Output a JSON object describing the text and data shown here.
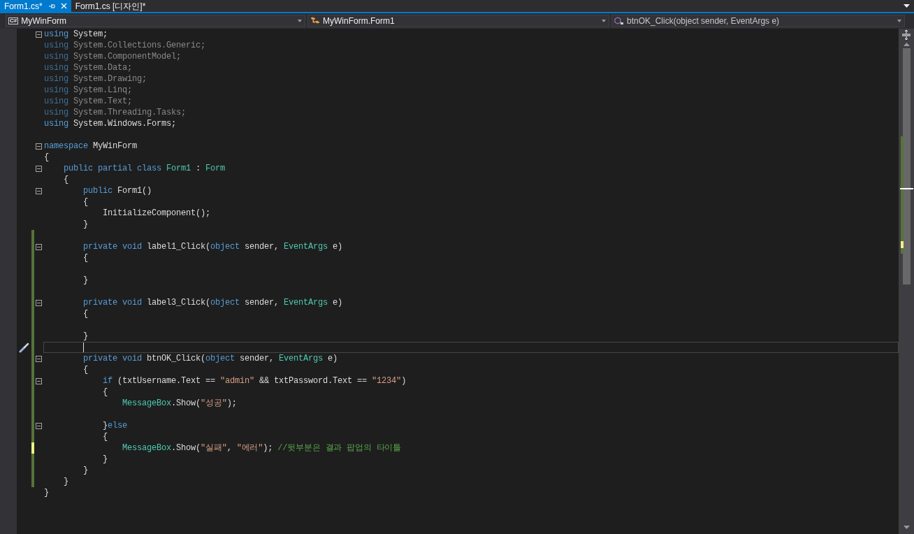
{
  "tabs": [
    {
      "label": "Form1.cs*",
      "selected": true,
      "pinned": true
    },
    {
      "label": "Form1.cs [디자인]*",
      "selected": false,
      "pinned": false
    }
  ],
  "nav_bar": {
    "project_icon": "C#",
    "project": "MyWinForm",
    "class": "MyWinForm.Form1",
    "member": "btnOK_Click(object sender, EventArgs e)"
  },
  "lines": [
    {
      "fold": true,
      "current": false,
      "tokens": [
        {
          "kind": "keyword",
          "text": "using"
        },
        {
          "kind": "plain",
          "text": " System;"
        }
      ]
    },
    {
      "fold": false,
      "current": false,
      "tokens": [
        {
          "kind": "dim_keyword",
          "text": "using"
        },
        {
          "kind": "dim",
          "text": " System.Collections.Generic;"
        }
      ]
    },
    {
      "fold": false,
      "current": false,
      "tokens": [
        {
          "kind": "dim_keyword",
          "text": "using"
        },
        {
          "kind": "dim",
          "text": " System.ComponentModel;"
        }
      ]
    },
    {
      "fold": false,
      "current": false,
      "tokens": [
        {
          "kind": "dim_keyword",
          "text": "using"
        },
        {
          "kind": "dim",
          "text": " System.Data;"
        }
      ]
    },
    {
      "fold": false,
      "current": false,
      "tokens": [
        {
          "kind": "dim_keyword",
          "text": "using"
        },
        {
          "kind": "dim",
          "text": " System.Drawing;"
        }
      ]
    },
    {
      "fold": false,
      "current": false,
      "tokens": [
        {
          "kind": "dim_keyword",
          "text": "using"
        },
        {
          "kind": "dim",
          "text": " System.Linq;"
        }
      ]
    },
    {
      "fold": false,
      "current": false,
      "tokens": [
        {
          "kind": "dim_keyword",
          "text": "using"
        },
        {
          "kind": "dim",
          "text": " System.Text;"
        }
      ]
    },
    {
      "fold": false,
      "current": false,
      "tokens": [
        {
          "kind": "dim_keyword",
          "text": "using"
        },
        {
          "kind": "dim",
          "text": " System.Threading.Tasks;"
        }
      ]
    },
    {
      "fold": false,
      "current": false,
      "tokens": [
        {
          "kind": "keyword",
          "text": "using"
        },
        {
          "kind": "plain",
          "text": " System.Windows.Forms;"
        }
      ]
    },
    {
      "fold": false,
      "current": false
    },
    {
      "fold": true,
      "current": false,
      "tokens": [
        {
          "kind": "keyword",
          "text": "namespace"
        },
        {
          "kind": "plain",
          "text": " MyWinForm"
        }
      ]
    },
    {
      "fold": false,
      "current": false,
      "tokens": [
        {
          "kind": "plain",
          "text": "{"
        }
      ]
    },
    {
      "fold": true,
      "current": false,
      "tokens": [
        {
          "kind": "keyword",
          "text": "    public partial class "
        },
        {
          "kind": "type",
          "text": "Form1"
        },
        {
          "kind": "plain",
          "text": " : "
        },
        {
          "kind": "type",
          "text": "Form"
        }
      ]
    },
    {
      "fold": false,
      "current": false,
      "tokens": [
        {
          "kind": "plain",
          "text": "    {"
        }
      ]
    },
    {
      "fold": true,
      "current": false,
      "tokens": [
        {
          "kind": "keyword",
          "text": "        public"
        },
        {
          "kind": "plain",
          "text": " Form1()"
        }
      ]
    },
    {
      "fold": false,
      "current": false,
      "tokens": [
        {
          "kind": "plain",
          "text": "        {"
        }
      ]
    },
    {
      "fold": false,
      "current": false,
      "tokens": [
        {
          "kind": "plain",
          "text": "            InitializeComponent();"
        }
      ]
    },
    {
      "fold": false,
      "current": false,
      "tokens": [
        {
          "kind": "plain",
          "text": "        }"
        }
      ]
    },
    {
      "fold": false,
      "color": "#57733a",
      "current": false
    },
    {
      "fold": true,
      "color": "#57733a",
      "current": false,
      "tokens": [
        {
          "kind": "keyword",
          "text": "        private void"
        },
        {
          "kind": "plain",
          "text": " label1_Click("
        },
        {
          "kind": "keyword",
          "text": "object"
        },
        {
          "kind": "plain",
          "text": " sender, "
        },
        {
          "kind": "type",
          "text": "EventArgs"
        },
        {
          "kind": "plain",
          "text": " e)"
        }
      ]
    },
    {
      "fold": false,
      "color": "#57733a",
      "current": false,
      "tokens": [
        {
          "kind": "plain",
          "text": "        {"
        }
      ]
    },
    {
      "fold": false,
      "color": "#57733a",
      "current": false
    },
    {
      "fold": false,
      "color": "#57733a",
      "current": false,
      "tokens": [
        {
          "kind": "plain",
          "text": "        }"
        }
      ]
    },
    {
      "fold": false,
      "color": "#57733a",
      "current": false
    },
    {
      "fold": true,
      "color": "#57733a",
      "current": false,
      "tokens": [
        {
          "kind": "keyword",
          "text": "        private void"
        },
        {
          "kind": "plain",
          "text": " label3_Click("
        },
        {
          "kind": "keyword",
          "text": "object"
        },
        {
          "kind": "plain",
          "text": " sender, "
        },
        {
          "kind": "type",
          "text": "EventArgs"
        },
        {
          "kind": "plain",
          "text": " e)"
        }
      ]
    },
    {
      "fold": false,
      "color": "#57733a",
      "current": false,
      "tokens": [
        {
          "kind": "plain",
          "text": "        {"
        }
      ]
    },
    {
      "fold": false,
      "color": "#57733a",
      "current": false
    },
    {
      "fold": false,
      "color": "#57733a",
      "current": false,
      "tokens": [
        {
          "kind": "plain",
          "text": "        }"
        }
      ]
    },
    {
      "fold": false,
      "color": "#57733a",
      "current": true
    },
    {
      "fold": true,
      "color": "#57733a",
      "current": false,
      "tokens": [
        {
          "kind": "keyword",
          "text": "        private void"
        },
        {
          "kind": "plain",
          "text": " btnOK_Click("
        },
        {
          "kind": "keyword",
          "text": "object"
        },
        {
          "kind": "plain",
          "text": " sender, "
        },
        {
          "kind": "type",
          "text": "EventArgs"
        },
        {
          "kind": "plain",
          "text": " e)"
        }
      ]
    },
    {
      "fold": false,
      "color": "#57733a",
      "current": false,
      "tokens": [
        {
          "kind": "plain",
          "text": "        {"
        }
      ]
    },
    {
      "fold": true,
      "color": "#57733a",
      "current": false,
      "tokens": [
        {
          "kind": "keyword",
          "text": "            if"
        },
        {
          "kind": "plain",
          "text": " (txtUsername.Text == "
        },
        {
          "kind": "string",
          "text": "\"admin\""
        },
        {
          "kind": "plain",
          "text": " && txtPassword.Text == "
        },
        {
          "kind": "string",
          "text": "\"1234\""
        },
        {
          "kind": "plain",
          "text": ")"
        }
      ]
    },
    {
      "fold": false,
      "color": "#57733a",
      "current": false,
      "tokens": [
        {
          "kind": "plain",
          "text": "            {"
        }
      ]
    },
    {
      "fold": false,
      "color": "#57733a",
      "current": false,
      "tokens": [
        {
          "kind": "type",
          "text": "                MessageBox"
        },
        {
          "kind": "plain",
          "text": ".Show("
        },
        {
          "kind": "string",
          "text": "\"성공\""
        },
        {
          "kind": "plain",
          "text": ");"
        }
      ]
    },
    {
      "fold": false,
      "color": "#57733a",
      "current": false
    },
    {
      "fold": true,
      "color": "#57733a",
      "current": false,
      "tokens": [
        {
          "kind": "plain",
          "text": "            }"
        },
        {
          "kind": "keyword",
          "text": "else"
        }
      ]
    },
    {
      "fold": false,
      "color": "#57733a",
      "current": false,
      "tokens": [
        {
          "kind": "plain",
          "text": "            {"
        }
      ]
    },
    {
      "fold": false,
      "color": "#eff284",
      "current": false,
      "tokens": [
        {
          "kind": "type",
          "text": "                MessageBox"
        },
        {
          "kind": "plain",
          "text": ".Show("
        },
        {
          "kind": "string",
          "text": "\"실패\""
        },
        {
          "kind": "plain",
          "text": ", "
        },
        {
          "kind": "string",
          "text": "\"에러\""
        },
        {
          "kind": "plain",
          "text": "); "
        },
        {
          "kind": "comment",
          "text": "//뒷부분은 결과 팝업의 타이틀"
        }
      ]
    },
    {
      "fold": false,
      "color": "#57733a",
      "current": false,
      "tokens": [
        {
          "kind": "plain",
          "text": "            }"
        }
      ]
    },
    {
      "fold": false,
      "color": "#57733a",
      "current": false,
      "tokens": [
        {
          "kind": "plain",
          "text": "        }"
        }
      ]
    },
    {
      "fold": false,
      "color": "#57733a",
      "current": false,
      "tokens": [
        {
          "kind": "plain",
          "text": "    }"
        }
      ]
    },
    {
      "fold": false,
      "current": false,
      "tokens": [
        {
          "kind": "plain",
          "text": "}"
        }
      ]
    }
  ]
}
